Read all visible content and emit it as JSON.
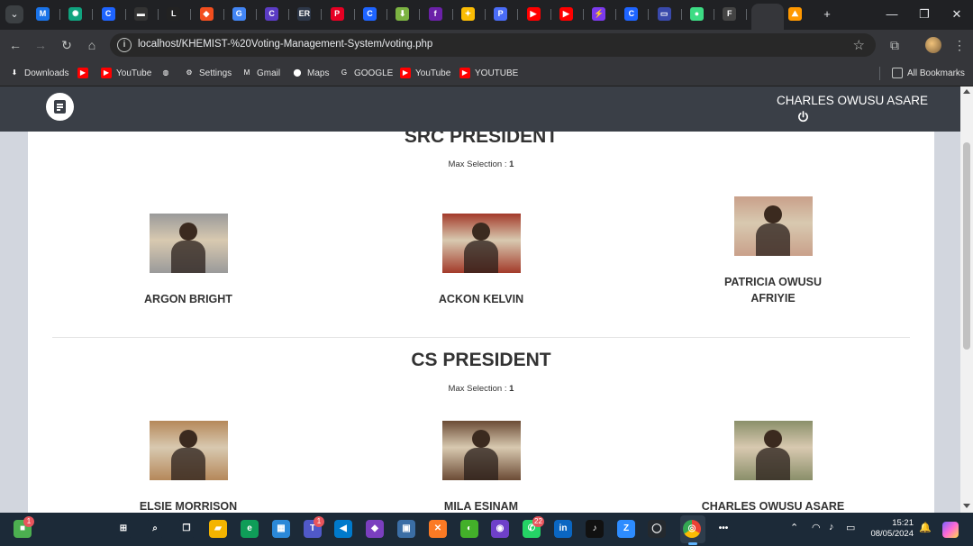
{
  "browser": {
    "tabs": [
      {
        "name": "tab-gmail",
        "glyph": "M",
        "color": "#1a73e8"
      },
      {
        "name": "tab-chatgpt",
        "glyph": "✺",
        "color": "#10a37f"
      },
      {
        "name": "tab-c1",
        "glyph": "C",
        "color": "#1e64ff"
      },
      {
        "name": "tab-dark",
        "glyph": "▬",
        "color": "#333333"
      },
      {
        "name": "tab-l",
        "glyph": "L",
        "color": "#222222"
      },
      {
        "name": "tab-figma",
        "glyph": "◆",
        "color": "#f24e1e"
      },
      {
        "name": "tab-google",
        "glyph": "G",
        "color": "#4285f4"
      },
      {
        "name": "tab-c2",
        "glyph": "C",
        "color": "#5b3cc4"
      },
      {
        "name": "tab-er",
        "glyph": "ER",
        "color": "#2d3748"
      },
      {
        "name": "tab-pinterest",
        "glyph": "P",
        "color": "#e60023"
      },
      {
        "name": "tab-c3",
        "glyph": "C",
        "color": "#1e64ff"
      },
      {
        "name": "tab-download",
        "glyph": "⬇",
        "color": "#7cb342"
      },
      {
        "name": "tab-f",
        "glyph": "f",
        "color": "#6b21a8"
      },
      {
        "name": "tab-bulb",
        "glyph": "✦",
        "color": "#fbbc04"
      },
      {
        "name": "tab-p",
        "glyph": "P",
        "color": "#4a6cf7"
      },
      {
        "name": "tab-youtube-1",
        "glyph": "▶",
        "color": "#ff0000"
      },
      {
        "name": "tab-youtube-2",
        "glyph": "▶",
        "color": "#ff0000"
      },
      {
        "name": "tab-bolt",
        "glyph": "⚡",
        "color": "#7c3aed"
      },
      {
        "name": "tab-c4",
        "glyph": "C",
        "color": "#1e64ff"
      },
      {
        "name": "tab-slides",
        "glyph": "▭",
        "color": "#3949ab"
      },
      {
        "name": "tab-android",
        "glyph": "●",
        "color": "#3ddc84"
      },
      {
        "name": "tab-f2",
        "glyph": "F",
        "color": "#444444"
      },
      {
        "name": "tab-dribbble",
        "glyph": "◎",
        "color": "#ea4c89"
      },
      {
        "name": "tab-active",
        "glyph": "⛰",
        "color": "#ff9800"
      }
    ],
    "new_tab": "+",
    "url": "localhost/KHEMIST-%20Voting-Management-System/voting.php",
    "bookmarks": [
      {
        "label": "Downloads",
        "icon": "download-icon",
        "glyph": "⬇",
        "color": "#35363a"
      },
      {
        "label": "",
        "icon": "youtube-icon",
        "glyph": "▶",
        "color": "#ff0000"
      },
      {
        "label": "YouTube",
        "icon": "youtube-icon",
        "glyph": "▶",
        "color": "#ff0000"
      },
      {
        "label": "",
        "icon": "globe-icon",
        "glyph": "◍",
        "color": "#35363a"
      },
      {
        "label": "Settings",
        "icon": "gear-icon",
        "glyph": "⚙",
        "color": "#35363a"
      },
      {
        "label": "Gmail",
        "icon": "gmail-icon",
        "glyph": "M",
        "color": "#35363a"
      },
      {
        "label": "Maps",
        "icon": "maps-icon",
        "glyph": "⬤",
        "color": "#35363a"
      },
      {
        "label": "GOOGLE",
        "icon": "google-icon",
        "glyph": "G",
        "color": "#35363a"
      },
      {
        "label": "YouTube",
        "icon": "youtube-icon",
        "glyph": "▶",
        "color": "#ff0000"
      },
      {
        "label": "YOUTUBE",
        "icon": "youtube-icon",
        "glyph": "▶",
        "color": "#ff0000"
      }
    ],
    "all_bookmarks": "All Bookmarks"
  },
  "app": {
    "user_name": "CHARLES OWUSU ASARE"
  },
  "ballot": {
    "max_label": "Max Selection : ",
    "positions": [
      {
        "title": "SRC PRESIDENT",
        "max": "1",
        "candidates": [
          {
            "name": "ARGON BRIGHT",
            "photo_bg": "#9a9a9a"
          },
          {
            "name": "ACKON KELVIN",
            "photo_bg": "#a33a2a"
          },
          {
            "name": "PATRICIA OWUSU AFRIYIE",
            "photo_bg": "#c9a08a"
          }
        ]
      },
      {
        "title": "CS PRESIDENT",
        "max": "1",
        "candidates": [
          {
            "name": "ELSIE MORRISON",
            "photo_bg": "#b5885a"
          },
          {
            "name": "MILA ESINAM",
            "photo_bg": "#6b4b35"
          },
          {
            "name": "CHARLES OWUSU ASARE",
            "photo_bg": "#8a8f6a"
          }
        ]
      }
    ]
  },
  "taskbar": {
    "apps": [
      {
        "name": "store-app",
        "glyph": "■",
        "color": "#4caf50",
        "badge": "1"
      },
      {
        "name": "start-button",
        "glyph": "⊞",
        "color": "#1c2a38",
        "badge": ""
      },
      {
        "name": "search-button",
        "glyph": "⌕",
        "color": "#1c2a38",
        "badge": ""
      },
      {
        "name": "task-view",
        "glyph": "❐",
        "color": "#1c2a38",
        "badge": ""
      },
      {
        "name": "file-explorer",
        "glyph": "▰",
        "color": "#f4b400",
        "badge": ""
      },
      {
        "name": "edge-browser",
        "glyph": "e",
        "color": "#0f9d58",
        "badge": ""
      },
      {
        "name": "ms-store",
        "glyph": "▦",
        "color": "#2b88d8",
        "badge": ""
      },
      {
        "name": "teams-app",
        "glyph": "T",
        "color": "#5059c9",
        "badge": "1"
      },
      {
        "name": "vscode-app",
        "glyph": "◀",
        "color": "#007acc",
        "badge": ""
      },
      {
        "name": "visual-studio-app",
        "glyph": "◆",
        "color": "#7b3fbf",
        "badge": ""
      },
      {
        "name": "ssms-app",
        "glyph": "▣",
        "color": "#3b6ea5",
        "badge": ""
      },
      {
        "name": "xampp-app",
        "glyph": "✕",
        "color": "#fb7a24",
        "badge": ""
      },
      {
        "name": "anaconda-app",
        "glyph": "◐",
        "color": "#43b02a",
        "badge": ""
      },
      {
        "name": "github-desktop-app",
        "glyph": "◉",
        "color": "#6e40c9",
        "badge": ""
      },
      {
        "name": "whatsapp-app",
        "glyph": "✆",
        "color": "#25d366",
        "badge": "22"
      },
      {
        "name": "linkedin-app",
        "glyph": "in",
        "color": "#0a66c2",
        "badge": ""
      },
      {
        "name": "tiktok-app",
        "glyph": "♪",
        "color": "#111111",
        "badge": ""
      },
      {
        "name": "zoom-app",
        "glyph": "Z",
        "color": "#2d8cff",
        "badge": ""
      },
      {
        "name": "github-app",
        "glyph": "◯",
        "color": "#24292e",
        "badge": ""
      },
      {
        "name": "chrome-app",
        "glyph": "◎",
        "color": "#1c2a38",
        "badge": ""
      },
      {
        "name": "overflow-button",
        "glyph": "•••",
        "color": "#1c2a38",
        "badge": ""
      }
    ],
    "time": "15:21",
    "date": "08/05/2024"
  }
}
